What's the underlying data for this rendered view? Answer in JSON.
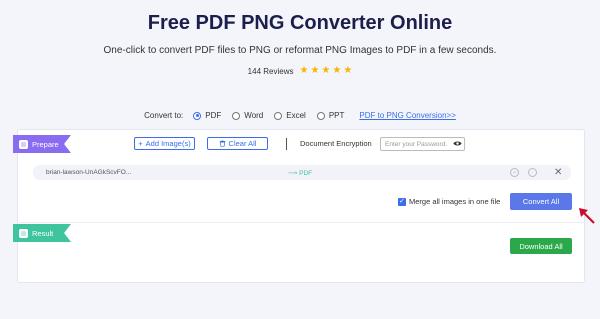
{
  "header": {
    "title": "Free PDF PNG Converter Online",
    "subtitle": "One-click to convert PDF files to PNG or reformat PNG Images to PDF in a few seconds.",
    "reviews": "144 Reviews",
    "rating_stars": 5
  },
  "convert": {
    "label": "Convert to:",
    "options": [
      "PDF",
      "Word",
      "Excel",
      "PPT"
    ],
    "selected": "PDF",
    "link": "PDF to PNG Conversion>>"
  },
  "prepare": {
    "label": "Prepare",
    "add_images": "Add Image(s)",
    "clear_all": "Clear All",
    "encryption_label": "Document Encryption",
    "password_placeholder": "Enter your Password."
  },
  "file": {
    "name": "brian-lawson-UnAGkScvFO...",
    "target": "PDF"
  },
  "merge": {
    "label": "Merge all images in one file",
    "checked": true
  },
  "actions": {
    "convert_all": "Convert All",
    "download_all": "Download All"
  },
  "result": {
    "label": "Result"
  },
  "colors": {
    "accent": "#3b6ee8",
    "prepare_tag": "#8a6cf2",
    "result_tag": "#3fc4a0",
    "download": "#2ba84a",
    "stars": "#f7b500",
    "annotation_arrow": "#c8102e"
  },
  "icons": [
    "plus-icon",
    "trash-icon",
    "eye-icon",
    "arrow-right-icon",
    "close-icon",
    "hand-icon",
    "star-icon"
  ]
}
